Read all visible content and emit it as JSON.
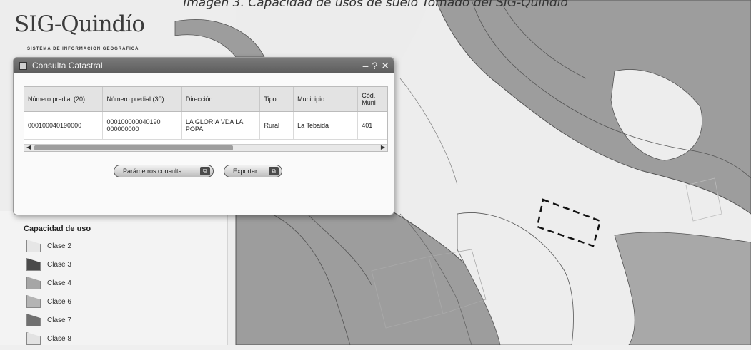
{
  "caption": "Imagen 3. Capacidad de usos de suelo Tomado del SIG-Quindío",
  "logo": {
    "title": "SIG-Quindío",
    "subtitle": "SISTEMA DE INFORMACIÓN GEOGRÁFICA"
  },
  "dialog": {
    "title": "Consulta Catastral",
    "controls": {
      "minimize": "–",
      "help": "?",
      "close": "✕"
    },
    "table": {
      "columns": [
        "Número predial (20)",
        "Número predial (30)",
        "Dirección",
        "Tipo",
        "Municipio",
        "Cód. Muni"
      ],
      "rows": [
        [
          "000100040190000",
          "000100000040190 000000000",
          "LA GLORIA VDA LA POPA",
          "Rural",
          "La Tebaida",
          "401"
        ]
      ]
    },
    "buttons": {
      "params": "Parámetros consulta",
      "export": "Exportar"
    }
  },
  "legend": {
    "title": "Capacidad de uso",
    "items": [
      {
        "label": "Clase 2",
        "color": "#e6e6e6"
      },
      {
        "label": "Clase 3",
        "color": "#4a4a4a"
      },
      {
        "label": "Clase 4",
        "color": "#a6a6a6"
      },
      {
        "label": "Clase 6",
        "color": "#b4b4b4"
      },
      {
        "label": "Clase 7",
        "color": "#707070"
      },
      {
        "label": "Clase 8",
        "color": "#e2e2e2"
      }
    ]
  },
  "map_colors": {
    "light": "#ececec",
    "dark": "#9d9d9d",
    "panel": "#f3f3f3"
  }
}
